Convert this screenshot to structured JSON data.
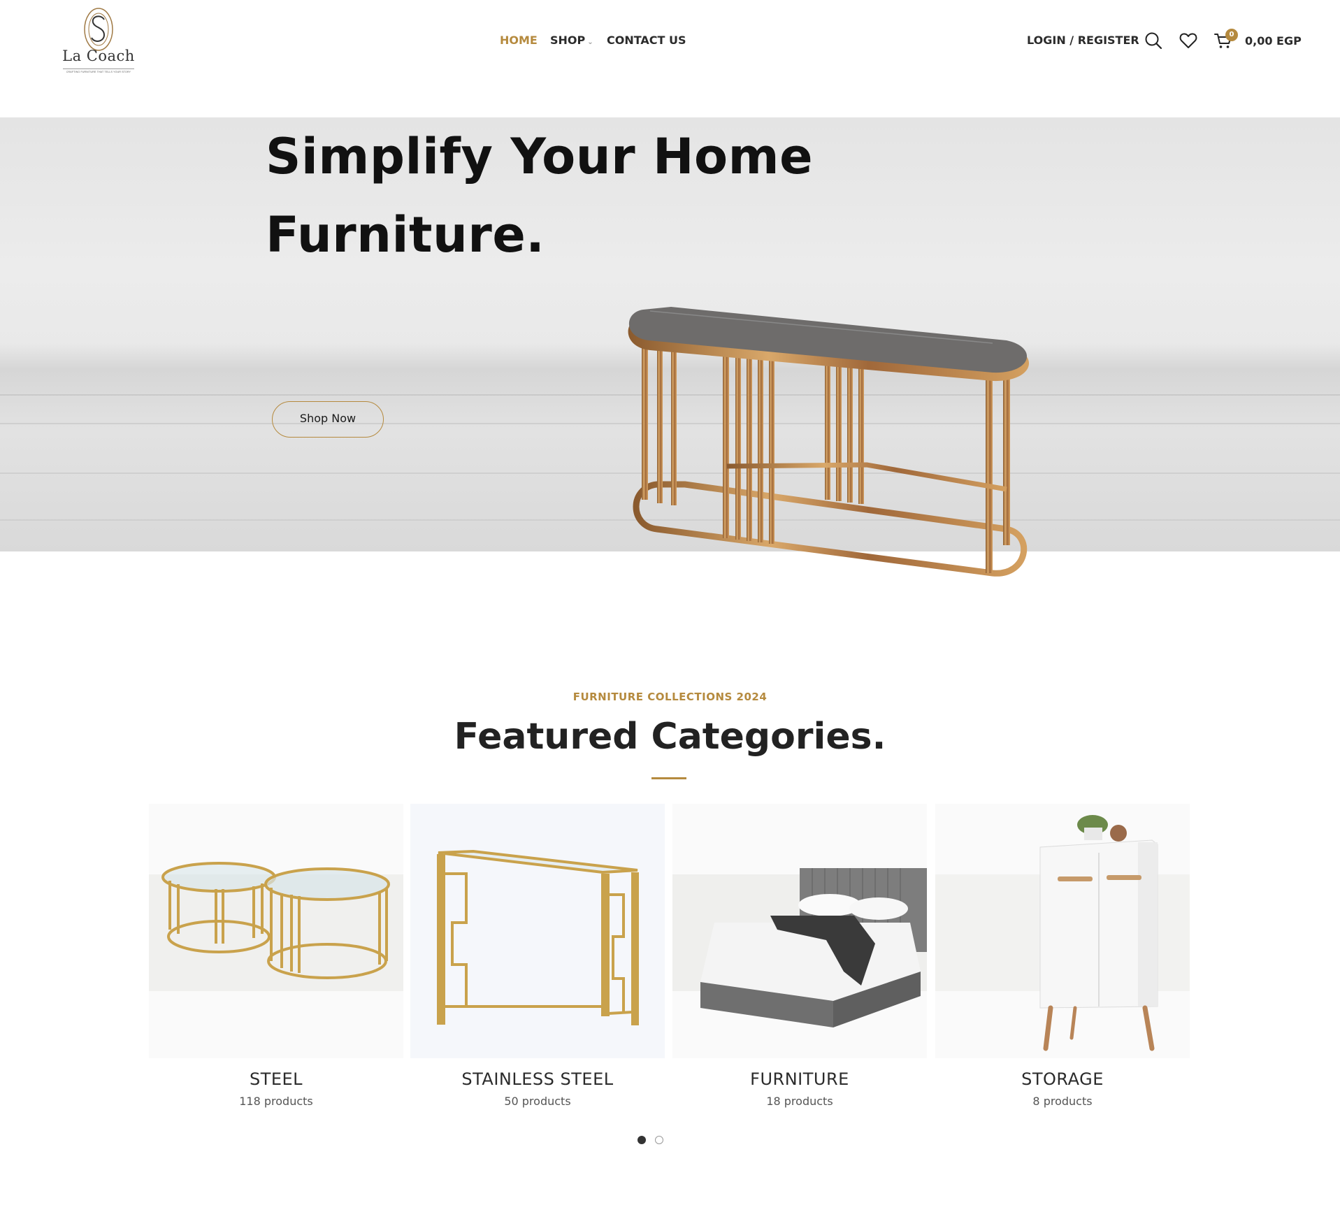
{
  "brand": {
    "name": "La Coach",
    "tagline": "CRAFTING FURNITURE THAT TELLS YOUR STORY",
    "accent_color": "#b58a3e"
  },
  "nav": {
    "home": "HOME",
    "shop": "SHOP",
    "contact": "CONTACT US"
  },
  "header_right": {
    "login": "LOGIN / REGISTER",
    "search_icon": "search-icon",
    "wishlist_icon": "heart-icon",
    "cart_icon": "cart-icon",
    "cart_count": "0",
    "cart_total": "0,00 EGP"
  },
  "hero": {
    "title_line1": "Simplify Your Home",
    "title_line2": "Furniture.",
    "button": "Shop Now"
  },
  "featured": {
    "subtitle": "FURNITURE COLLECTIONS 2024",
    "title": "Featured Categories.",
    "categories": [
      {
        "name": "STEEL",
        "count": "118 products"
      },
      {
        "name": "STAINLESS STEEL",
        "count": "50 products"
      },
      {
        "name": "FURNITURE",
        "count": "18 products"
      },
      {
        "name": "STORAGE",
        "count": "8 products"
      }
    ],
    "carousel_pages": 2,
    "carousel_active": 1
  }
}
